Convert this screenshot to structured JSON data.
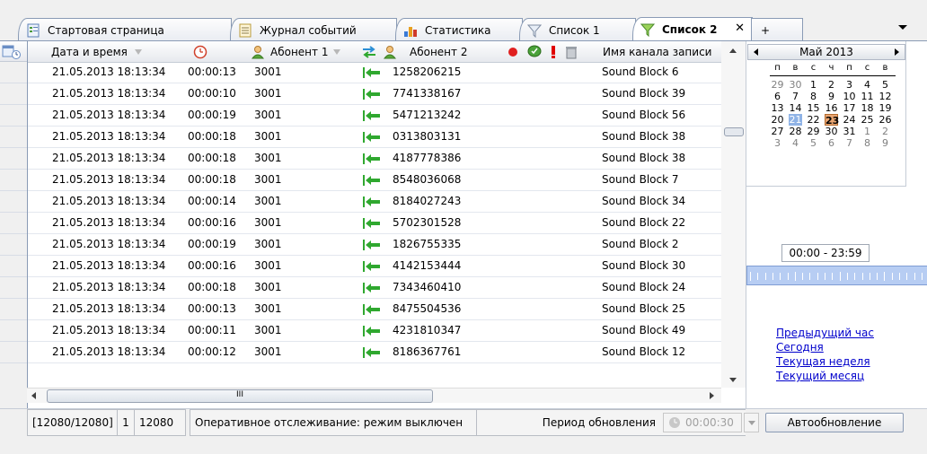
{
  "tabs": [
    {
      "label": "Стартовая страница",
      "icon": "home-page-icon",
      "active": false
    },
    {
      "label": "Журнал событий",
      "icon": "journal-icon",
      "active": false
    },
    {
      "label": "Статистика",
      "icon": "bar-chart-icon",
      "active": false
    },
    {
      "label": "Список 1",
      "icon": "filter-icon",
      "active": false
    },
    {
      "label": "Список 2",
      "icon": "filter-active-icon",
      "active": true
    }
  ],
  "tab_close": "✕",
  "tab_add": "+",
  "columns": {
    "datetime": "Дата и время",
    "subscriber1": "Абонент 1",
    "subscriber2": "Абонент 2",
    "channel": "Имя канала записи"
  },
  "colors": {
    "accent": "#316ac5",
    "arrow": "#2fa82f",
    "record": "#e02020",
    "warn": "#e00000",
    "selected_day": "#8fb3e6",
    "today": "#e9a571"
  },
  "rows": [
    {
      "datetime": "21.05.2013 18:13:34",
      "duration": "00:00:13",
      "sub1": "3001",
      "sub2": "1258206215",
      "channel": "Sound Block 6"
    },
    {
      "datetime": "21.05.2013 18:13:34",
      "duration": "00:00:10",
      "sub1": "3001",
      "sub2": "7741338167",
      "channel": "Sound Block 39"
    },
    {
      "datetime": "21.05.2013 18:13:34",
      "duration": "00:00:19",
      "sub1": "3001",
      "sub2": "5471213242",
      "channel": "Sound Block 56"
    },
    {
      "datetime": "21.05.2013 18:13:34",
      "duration": "00:00:18",
      "sub1": "3001",
      "sub2": "0313803131",
      "channel": "Sound Block 38"
    },
    {
      "datetime": "21.05.2013 18:13:34",
      "duration": "00:00:18",
      "sub1": "3001",
      "sub2": "4187778386",
      "channel": "Sound Block 38"
    },
    {
      "datetime": "21.05.2013 18:13:34",
      "duration": "00:00:18",
      "sub1": "3001",
      "sub2": "8548036068",
      "channel": "Sound Block 7"
    },
    {
      "datetime": "21.05.2013 18:13:34",
      "duration": "00:00:14",
      "sub1": "3001",
      "sub2": "8184027243",
      "channel": "Sound Block 34"
    },
    {
      "datetime": "21.05.2013 18:13:34",
      "duration": "00:00:16",
      "sub1": "3001",
      "sub2": "5702301528",
      "channel": "Sound Block 22"
    },
    {
      "datetime": "21.05.2013 18:13:34",
      "duration": "00:00:19",
      "sub1": "3001",
      "sub2": "1826755335",
      "channel": "Sound Block 2"
    },
    {
      "datetime": "21.05.2013 18:13:34",
      "duration": "00:00:16",
      "sub1": "3001",
      "sub2": "4142153444",
      "channel": "Sound Block 30"
    },
    {
      "datetime": "21.05.2013 18:13:34",
      "duration": "00:00:18",
      "sub1": "3001",
      "sub2": "7343460410",
      "channel": "Sound Block 24"
    },
    {
      "datetime": "21.05.2013 18:13:34",
      "duration": "00:00:13",
      "sub1": "3001",
      "sub2": "8475504536",
      "channel": "Sound Block 25"
    },
    {
      "datetime": "21.05.2013 18:13:34",
      "duration": "00:00:11",
      "sub1": "3001",
      "sub2": "4231810347",
      "channel": "Sound Block 49"
    },
    {
      "datetime": "21.05.2013 18:13:34",
      "duration": "00:00:12",
      "sub1": "3001",
      "sub2": "8186367761",
      "channel": "Sound Block 12"
    }
  ],
  "hscroll_grip": "III",
  "calendar": {
    "title": "Май 2013",
    "weekdays": [
      "п",
      "в",
      "с",
      "ч",
      "п",
      "с",
      "в"
    ],
    "weeks": [
      [
        [
          "29",
          "other"
        ],
        [
          "30",
          "other"
        ],
        [
          "1",
          ""
        ],
        [
          "2",
          ""
        ],
        [
          "3",
          ""
        ],
        [
          "4",
          ""
        ],
        [
          "5",
          ""
        ]
      ],
      [
        [
          "6",
          ""
        ],
        [
          "7",
          ""
        ],
        [
          "8",
          ""
        ],
        [
          "9",
          ""
        ],
        [
          "10",
          ""
        ],
        [
          "11",
          ""
        ],
        [
          "12",
          ""
        ]
      ],
      [
        [
          "13",
          ""
        ],
        [
          "14",
          ""
        ],
        [
          "15",
          ""
        ],
        [
          "16",
          ""
        ],
        [
          "17",
          ""
        ],
        [
          "18",
          ""
        ],
        [
          "19",
          ""
        ]
      ],
      [
        [
          "20",
          ""
        ],
        [
          "21",
          "sel"
        ],
        [
          "22",
          ""
        ],
        [
          "23",
          "today"
        ],
        [
          "24",
          ""
        ],
        [
          "25",
          ""
        ],
        [
          "26",
          ""
        ]
      ],
      [
        [
          "27",
          ""
        ],
        [
          "28",
          ""
        ],
        [
          "29",
          ""
        ],
        [
          "30",
          ""
        ],
        [
          "31",
          ""
        ],
        [
          "1",
          "other"
        ],
        [
          "2",
          "other"
        ]
      ],
      [
        [
          "3",
          "other"
        ],
        [
          "4",
          "other"
        ],
        [
          "5",
          "other"
        ],
        [
          "6",
          "other"
        ],
        [
          "7",
          "other"
        ],
        [
          "8",
          "other"
        ],
        [
          "9",
          "other"
        ]
      ]
    ]
  },
  "time_range": "00:00 - 23:59",
  "quick_links": [
    "Предыдущий час",
    "Сегодня",
    "Текущая неделя",
    "Текущий месяц"
  ],
  "status": {
    "count": "[12080/12080]",
    "page": "1",
    "total": "12080",
    "monitoring": "Оперативное отслеживание: режим выключен",
    "period_label": "Период обновления",
    "period_value": "00:00:30",
    "auto_button": "Автообновление"
  }
}
